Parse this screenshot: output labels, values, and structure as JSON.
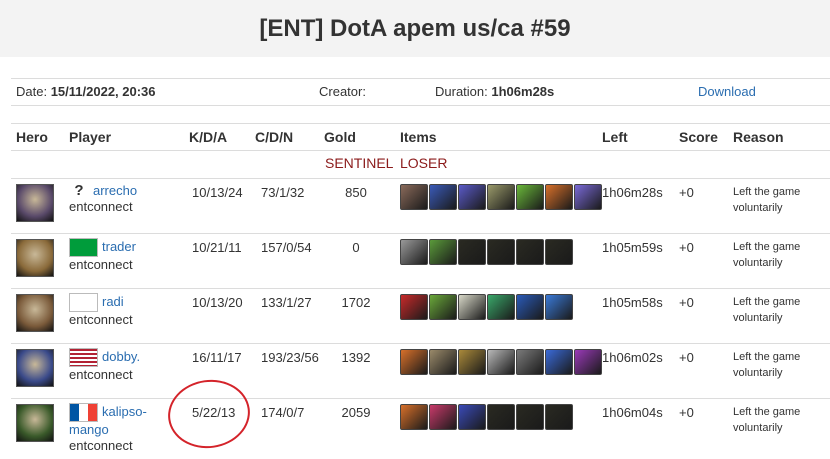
{
  "title": "[ENT] DotA apem us/ca #59",
  "info": {
    "date_label": "Date:",
    "date_value": "15/11/2022, 20:36",
    "creator_label": "Creator:",
    "duration_label": "Duration:",
    "duration_value": "1h06m28s",
    "download": "Download"
  },
  "columns": [
    "Hero",
    "Player",
    "K/D/A",
    "C/D/N",
    "Gold",
    "Items",
    "Left",
    "Score",
    "Reason"
  ],
  "team": {
    "name": "SENTINEL",
    "result": "LOSER"
  },
  "players": [
    {
      "name": "arrecho",
      "realm": "entconnect",
      "flag": "unknown",
      "kda": "10/13/24",
      "cdn": "73/1/32",
      "gold": "850",
      "left": "1h06m28s",
      "score": "+0",
      "reason": "Left the game voluntarily",
      "hero_color": "#5a4a6a",
      "items": [
        "#8a6a5a",
        "#3a5ab8",
        "#5a5ac8",
        "#9a9a6a",
        "#6ab83a",
        "#d8702a",
        "#7a6ad8"
      ]
    },
    {
      "name": "trader",
      "realm": "entconnect",
      "flag": "brazil",
      "kda": "10/21/11",
      "cdn": "157/0/54",
      "gold": "0",
      "left": "1h05m59s",
      "score": "+0",
      "reason": "Left the game voluntarily",
      "hero_color": "#8a6a3a",
      "items": [
        "#9a9a9a",
        "#5a9a3a",
        "#2a2a22",
        "#2a2a22",
        "#2a2a22",
        "#2a2a22"
      ]
    },
    {
      "name": "radi",
      "realm": "entconnect",
      "flag": "korea",
      "kda": "10/13/20",
      "cdn": "133/1/27",
      "gold": "1702",
      "left": "1h05m58s",
      "score": "+0",
      "reason": "Left the game voluntarily",
      "hero_color": "#7a5a3a",
      "items": [
        "#c82a2a",
        "#6aa83a",
        "#d8d8c8",
        "#3aa86a",
        "#2a5ab8",
        "#3a7ad8"
      ]
    },
    {
      "name": "dobby.",
      "realm": "entconnect",
      "flag": "usa",
      "kda": "16/11/17",
      "cdn": "193/23/56",
      "gold": "1392",
      "left": "1h06m02s",
      "score": "+0",
      "reason": "Left the game voluntarily",
      "hero_color": "#3a4a8a",
      "items": [
        "#d8702a",
        "#9a8a6a",
        "#aa8a3a",
        "#b8b8b8",
        "#7a7a7a",
        "#3a6ad8",
        "#9a3ab8"
      ]
    },
    {
      "name": "kalipso-mango",
      "name_line1": "kalipso-",
      "name_line2": "mango",
      "realm": "entconnect",
      "flag": "france",
      "kda": "5/22/13",
      "cdn": "174/0/7",
      "gold": "2059",
      "left": "1h06m04s",
      "score": "+0",
      "reason": "Left the game voluntarily",
      "hero_color": "#3a5a2a",
      "items": [
        "#d8702a",
        "#c83a6a",
        "#3a4ab8",
        "#2a2a22",
        "#2a2a22",
        "#2a2a22"
      ]
    }
  ]
}
